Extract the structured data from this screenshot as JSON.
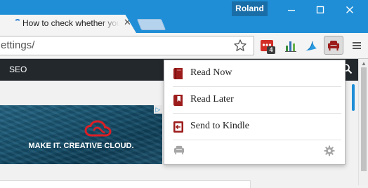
{
  "window": {
    "user_name": "Roland",
    "tab_title": "How to check whether your"
  },
  "toolbar": {
    "url": "ettings/",
    "lastpass_badge": "4",
    "accent_color": "#1f8ed6"
  },
  "site": {
    "nav_label": "SEO"
  },
  "ad": {
    "headline": "MAKE IT. CREATIVE CLOUD.",
    "adchoices": "▷",
    "brand_color": "#da1f26"
  },
  "popup": {
    "items": [
      {
        "label": "Read Now",
        "icon": "book-icon"
      },
      {
        "label": "Read Later",
        "icon": "bookmark-book-icon"
      },
      {
        "label": "Send to Kindle",
        "icon": "send-to-kindle-icon"
      }
    ],
    "footer_icons": [
      "sofa-icon",
      "gear-icon"
    ],
    "icon_color": "#9c1c1c"
  }
}
